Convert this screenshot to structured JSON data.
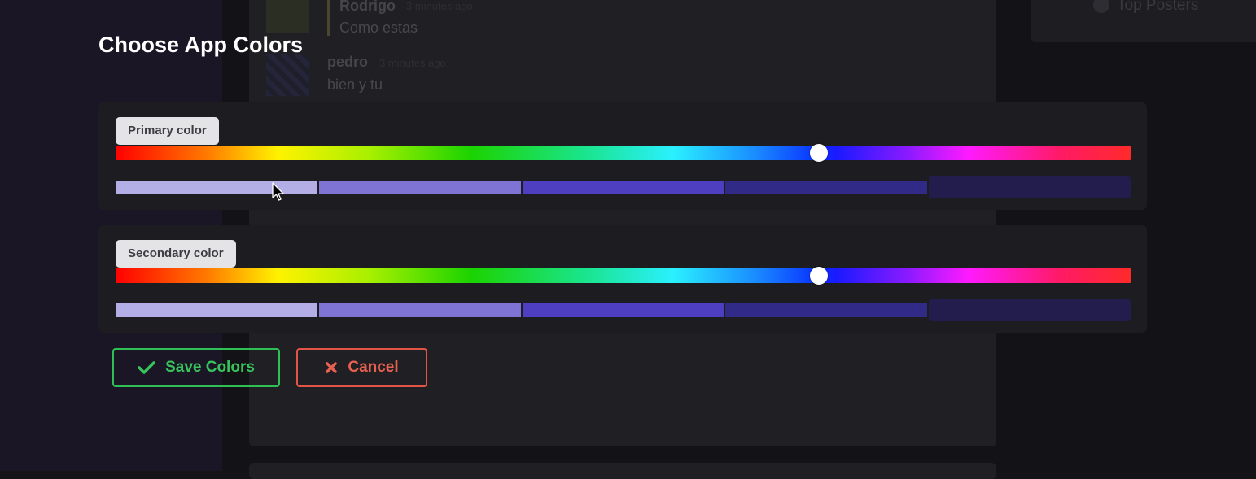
{
  "background": {
    "feed": [
      {
        "author": "Rodrigo",
        "time": "3 minutes ago",
        "message": "Como estas"
      },
      {
        "author": "pedro",
        "time": "3 minutes ago",
        "message": "bien y tu"
      }
    ],
    "right_panel_title": "Top Posters"
  },
  "modal": {
    "title": "Choose App Colors",
    "primary": {
      "label": "Primary color",
      "hue_fraction": 0.693,
      "shades": [
        "#b4aee6",
        "#7f74d4",
        "#4d3fc0",
        "#322a87",
        "#221d4c"
      ]
    },
    "secondary": {
      "label": "Secondary color",
      "hue_fraction": 0.693,
      "shades": [
        "#b4aee6",
        "#7f74d4",
        "#4d3fc0",
        "#322a87",
        "#221d4c"
      ]
    },
    "buttons": {
      "save_label": "Save Colors",
      "save_icon": "check-icon",
      "save_color": "#2fbf55",
      "cancel_label": "Cancel",
      "cancel_icon": "x-icon",
      "cancel_color": "#e05545"
    }
  }
}
